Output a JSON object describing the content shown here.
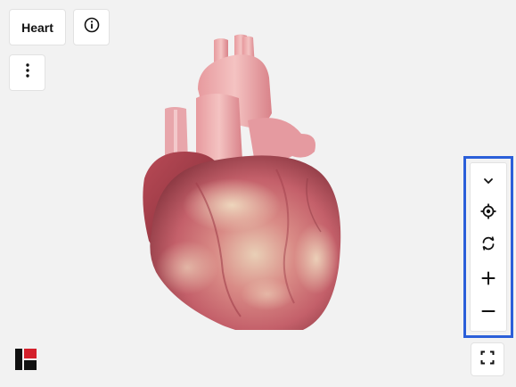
{
  "toolbar": {
    "title": "Heart",
    "info_icon": "info-icon",
    "menu_icon": "more-vertical-icon"
  },
  "viewer": {
    "model_name": "Heart",
    "controls": [
      {
        "name": "collapse-controls-button",
        "icon": "chevron-down-icon"
      },
      {
        "name": "recenter-button",
        "icon": "crosshair-target-icon"
      },
      {
        "name": "rotate-button",
        "icon": "refresh-rotate-icon"
      },
      {
        "name": "zoom-in-button",
        "icon": "plus-icon"
      },
      {
        "name": "zoom-out-button",
        "icon": "minus-icon"
      }
    ],
    "fullscreen_icon": "fullscreen-icon",
    "highlight_color": "#2b5fd9"
  },
  "brand": {
    "logo": "brand-logo",
    "colors": [
      "#111111",
      "#d4202b"
    ]
  }
}
